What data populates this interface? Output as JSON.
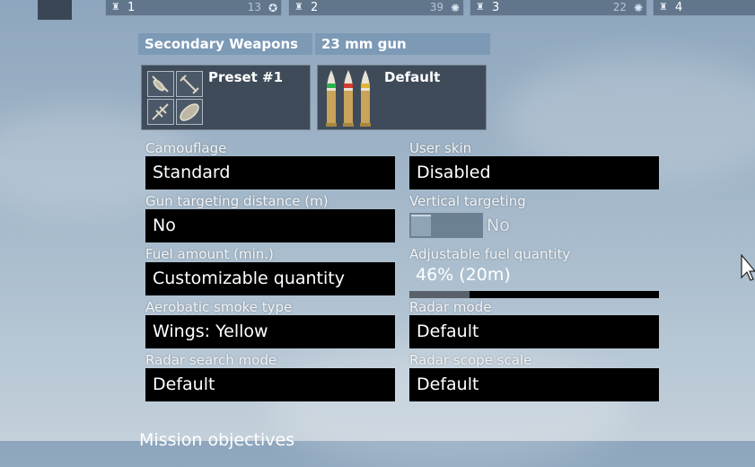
{
  "crew_slots": [
    {
      "num": "1",
      "level": "13"
    },
    {
      "num": "2",
      "level": "39"
    },
    {
      "num": "3",
      "level": "22"
    },
    {
      "num": "4",
      "level": ""
    }
  ],
  "weapons": {
    "secondary_header": "Secondary Weapons",
    "gun_header": "23 mm gun",
    "preset_label": "Preset #1",
    "ammo_label": "Default"
  },
  "settings": {
    "camouflage": {
      "label": "Camouflage",
      "value": "Standard"
    },
    "user_skin": {
      "label": "User skin",
      "value": "Disabled"
    },
    "gun_distance": {
      "label": "Gun targeting distance (m)",
      "value": "No"
    },
    "vertical_targeting": {
      "label": "Vertical targeting",
      "value": "No"
    },
    "fuel_amount": {
      "label": "Fuel amount (min.)",
      "value": "Customizable quantity"
    },
    "adjustable_fuel": {
      "label": "Adjustable fuel quantity",
      "value": "46% (20m)",
      "fraction": 0.24
    },
    "smoke_type": {
      "label": "Aerobatic smoke type",
      "value": "Wings: Yellow"
    },
    "radar_mode": {
      "label": "Radar mode",
      "value": "Default"
    },
    "radar_search": {
      "label": "Radar search mode",
      "value": "Default"
    },
    "radar_scope": {
      "label": "Radar scope scale",
      "value": "Default"
    }
  },
  "missions_heading": "Mission objectives"
}
